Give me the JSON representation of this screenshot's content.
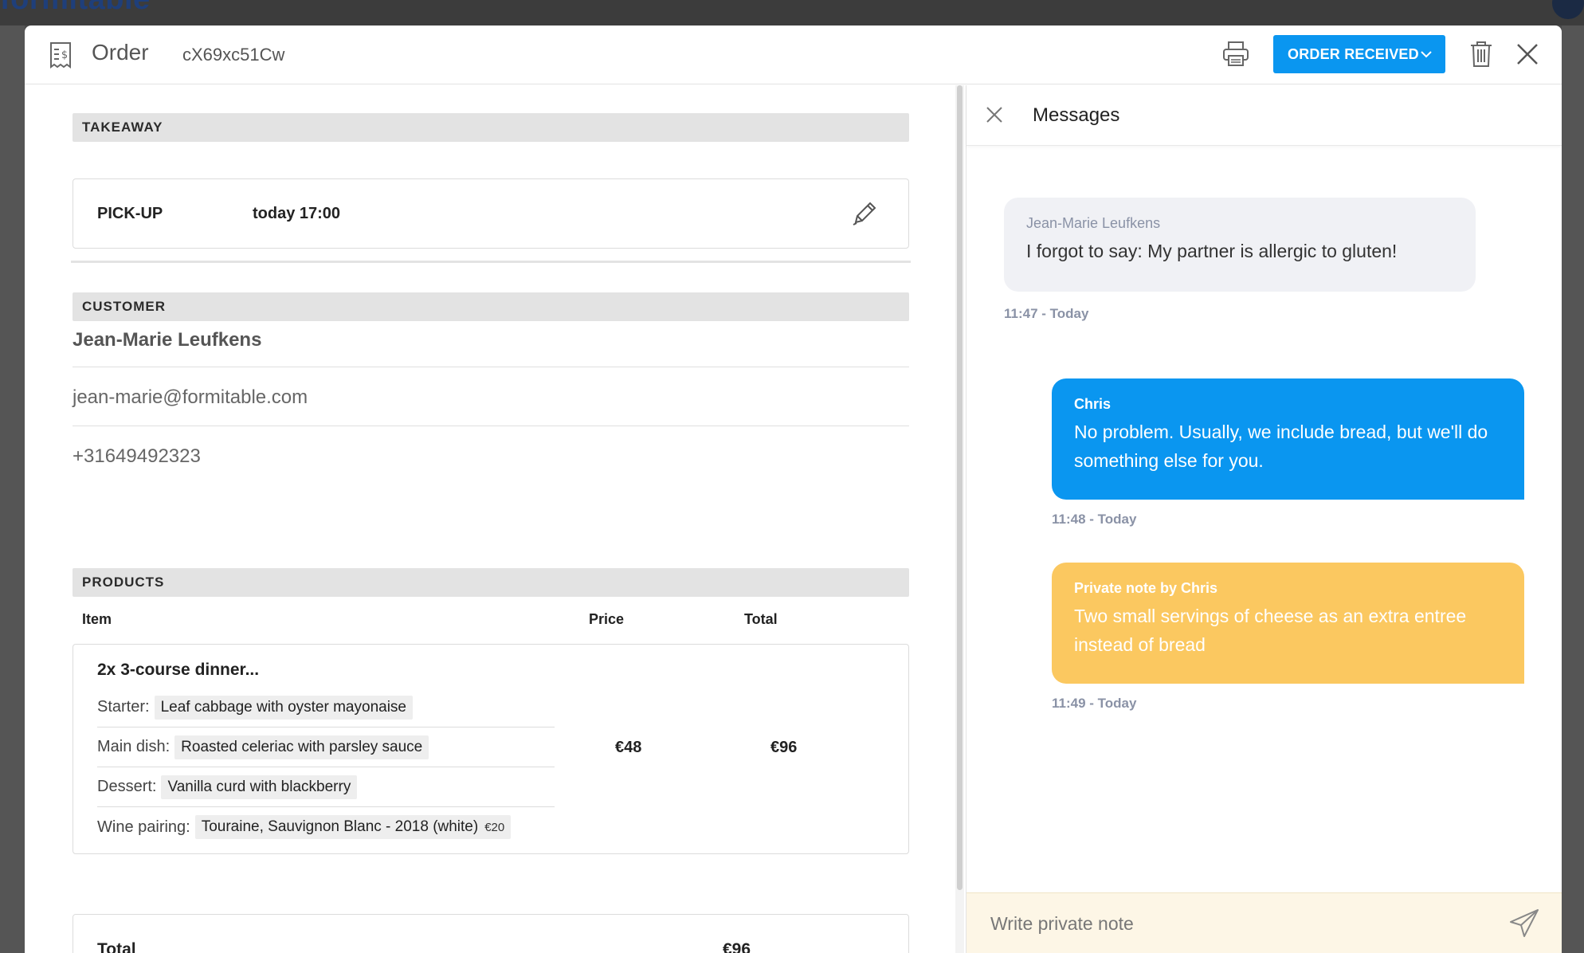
{
  "backdrop": {
    "logo_text": "formitable"
  },
  "header": {
    "title": "Order",
    "order_id": "cX69xc51Cw",
    "status_label": "ORDER RECEIVED"
  },
  "takeaway": {
    "section_label": "TAKEAWAY",
    "pickup_label": "PICK-UP",
    "pickup_time": "today 17:00"
  },
  "customer": {
    "section_label": "CUSTOMER",
    "name": "Jean-Marie Leufkens",
    "email": "jean-marie@formitable.com",
    "phone": "+31649492323"
  },
  "products": {
    "section_label": "PRODUCTS",
    "columns": {
      "item": "Item",
      "price": "Price",
      "total": "Total"
    },
    "items": [
      {
        "title": "2x 3-course dinner...",
        "price": "€48",
        "total": "€96",
        "options": [
          {
            "label": "Starter:",
            "value": "Leaf cabbage with oyster mayonaise",
            "extra": ""
          },
          {
            "label": "Main dish:",
            "value": "Roasted celeriac with parsley sauce",
            "extra": ""
          },
          {
            "label": "Dessert:",
            "value": "Vanilla curd with blackberry",
            "extra": ""
          },
          {
            "label": "Wine pairing:",
            "value": "Touraine, Sauvignon Blanc - 2018 (white)",
            "extra": "€20"
          }
        ]
      }
    ],
    "grand_total_label": "Total",
    "grand_total_value": "€96"
  },
  "messages": {
    "title": "Messages",
    "thread": [
      {
        "type": "customer",
        "author": "Jean-Marie Leufkens",
        "text": "I forgot to say: My partner is allergic to gluten!",
        "time": "11:47 - Today"
      },
      {
        "type": "staff",
        "author": "Chris",
        "text": "No problem. Usually, we include bread, but we'll do something else for you.",
        "time": "11:48 - Today"
      },
      {
        "type": "note",
        "author": "Private note by Chris",
        "text": "Two small servings of cheese as an extra entree instead of bread",
        "time": "11:49 - Today"
      }
    ],
    "compose_placeholder": "Write private note"
  },
  "colors": {
    "accent": "#0a96f0",
    "note": "#fbc860",
    "customer_bubble": "#f0f1f5",
    "compose_bg": "#fdf6e6"
  },
  "icons": {
    "header": [
      "receipt-icon",
      "printer-icon",
      "chevron-down-icon",
      "trash-icon",
      "close-icon"
    ],
    "pickup": "pencil-icon",
    "messages": [
      "close-icon",
      "send-icon"
    ]
  }
}
